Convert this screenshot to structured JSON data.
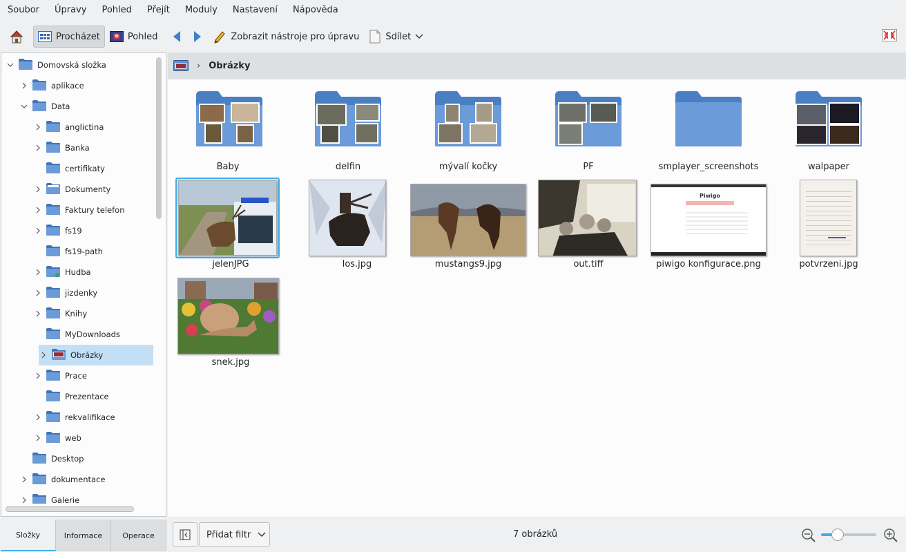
{
  "menu": [
    "Soubor",
    "Úpravy",
    "Pohled",
    "Přejít",
    "Moduly",
    "Nastavení",
    "Nápověda"
  ],
  "toolbar": {
    "browse": "Procházet",
    "view": "Pohled",
    "edit_tools": "Zobrazit nástroje pro úpravu",
    "share": "Sdílet"
  },
  "tree": {
    "root": "Domovská složka",
    "items": [
      {
        "label": "aplikace",
        "level": 1,
        "expander": "collapsed"
      },
      {
        "label": "Data",
        "level": 1,
        "expander": "expanded"
      },
      {
        "label": "anglictina",
        "level": 2,
        "expander": "collapsed"
      },
      {
        "label": "Banka",
        "level": 2,
        "expander": "collapsed"
      },
      {
        "label": "certifikaty",
        "level": 2,
        "expander": "none"
      },
      {
        "label": "Dokumenty",
        "level": 2,
        "expander": "collapsed"
      },
      {
        "label": "Faktury telefon",
        "level": 2,
        "expander": "collapsed"
      },
      {
        "label": "fs19",
        "level": 2,
        "expander": "collapsed"
      },
      {
        "label": "fs19-path",
        "level": 2,
        "expander": "none"
      },
      {
        "label": "Hudba",
        "level": 2,
        "expander": "collapsed"
      },
      {
        "label": "jizdenky",
        "level": 2,
        "expander": "collapsed"
      },
      {
        "label": "Knihy",
        "level": 2,
        "expander": "collapsed"
      },
      {
        "label": "MyDownloads",
        "level": 2,
        "expander": "none"
      },
      {
        "label": "Obrázky",
        "level": 2,
        "expander": "collapsed",
        "selected": true
      },
      {
        "label": "Prace",
        "level": 2,
        "expander": "collapsed"
      },
      {
        "label": "Prezentace",
        "level": 2,
        "expander": "none"
      },
      {
        "label": "rekvalifikace",
        "level": 2,
        "expander": "collapsed"
      },
      {
        "label": "web",
        "level": 2,
        "expander": "collapsed"
      },
      {
        "label": "Desktop",
        "level": 1,
        "expander": "none"
      },
      {
        "label": "dokumentace",
        "level": 1,
        "expander": "collapsed"
      },
      {
        "label": "Galerie",
        "level": 1,
        "expander": "collapsed"
      }
    ]
  },
  "left_tabs": [
    "Složky",
    "Informace",
    "Operace"
  ],
  "breadcrumb": {
    "current": "Obrázky"
  },
  "folders": [
    {
      "name": "Baby"
    },
    {
      "name": "delfin"
    },
    {
      "name": "mývalí kočky"
    },
    {
      "name": "PF"
    },
    {
      "name": "smplayer_screenshots"
    },
    {
      "name": "walpaper"
    }
  ],
  "files": [
    {
      "name": "jelenJPG",
      "selected": true
    },
    {
      "name": "los.jpg"
    },
    {
      "name": "mustangs9.jpg"
    },
    {
      "name": "out.tiff"
    },
    {
      "name": "piwigo konfigurace.png",
      "thumb_text": "Piwigo"
    },
    {
      "name": "potvrzeni.jpg"
    },
    {
      "name": "snek.jpg"
    }
  ],
  "status": {
    "filter": "Přidat filtr",
    "count": "7 obrázků",
    "zoom_level": 0.3
  },
  "colors": {
    "accent": "#3daee9",
    "folder": "#5f90cf",
    "selection": "#c2dff5"
  }
}
